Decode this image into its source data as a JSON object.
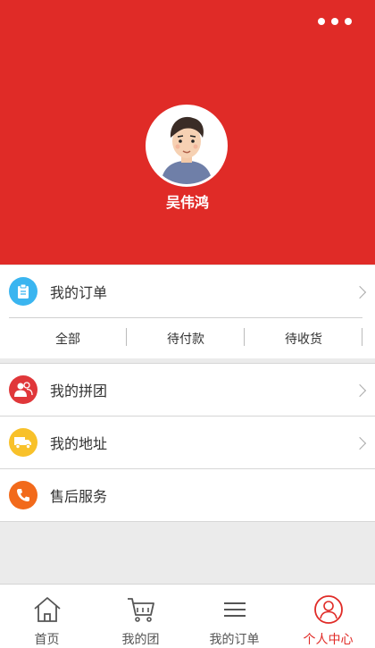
{
  "user": {
    "name": "吴伟鸿"
  },
  "menu": {
    "orders": {
      "label": "我的订单",
      "tabs": [
        "全部",
        "待付款",
        "待收货"
      ]
    },
    "group": {
      "label": "我的拼团"
    },
    "address": {
      "label": "我的地址"
    },
    "service": {
      "label": "售后服务"
    }
  },
  "tabbar": {
    "items": [
      {
        "label": "首页",
        "icon": "home-icon"
      },
      {
        "label": "我的团",
        "icon": "cart-icon"
      },
      {
        "label": "我的订单",
        "icon": "menu-icon"
      },
      {
        "label": "个人中心",
        "icon": "user-icon",
        "active": true
      }
    ]
  },
  "colors": {
    "brand": "#e02b27",
    "order_icon": "#3ab5f0",
    "group_icon": "#e0373a",
    "address_icon": "#f8c12a",
    "service_icon": "#f26a1b"
  }
}
